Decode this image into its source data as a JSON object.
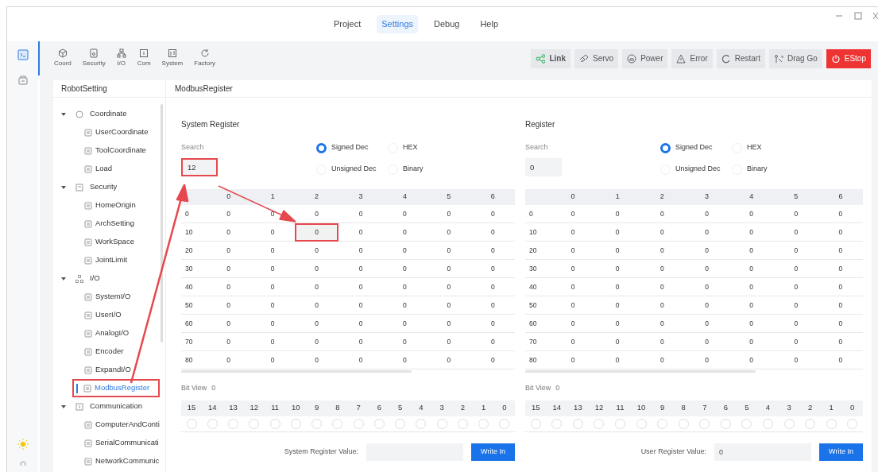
{
  "menu": [
    {
      "label": "Project",
      "selected": false
    },
    {
      "label": "Settings",
      "selected": true
    },
    {
      "label": "Debug",
      "selected": false
    },
    {
      "label": "Help",
      "selected": false
    }
  ],
  "toolbar": {
    "items": [
      {
        "label": "Coord"
      },
      {
        "label": "Security"
      },
      {
        "label": "I/O"
      },
      {
        "label": "Com"
      },
      {
        "label": "System"
      },
      {
        "label": "Factory"
      }
    ],
    "buttons": [
      {
        "label": "Link",
        "kind": "link"
      },
      {
        "label": "Servo",
        "kind": "servo"
      },
      {
        "label": "Power",
        "kind": "power"
      },
      {
        "label": "Error",
        "kind": "error"
      },
      {
        "label": "Restart",
        "kind": "restart"
      },
      {
        "label": "Drag Go",
        "kind": "drag"
      },
      {
        "label": "EStop",
        "kind": "estop"
      }
    ]
  },
  "tree": {
    "title": "RobotSetting",
    "groups": [
      {
        "label": "Coordinate",
        "expanded": true,
        "children": [
          {
            "label": "UserCoordinate",
            "selected": false,
            "highlighted": false
          },
          {
            "label": "ToolCoordinate",
            "selected": false,
            "highlighted": false
          },
          {
            "label": "Load",
            "selected": false,
            "highlighted": false
          }
        ]
      },
      {
        "label": "Security",
        "expanded": true,
        "children": [
          {
            "label": "HomeOrigin",
            "selected": false,
            "highlighted": false
          },
          {
            "label": "ArchSetting",
            "selected": false,
            "highlighted": false
          },
          {
            "label": "WorkSpace",
            "selected": false,
            "highlighted": false
          },
          {
            "label": "JointLimit",
            "selected": false,
            "highlighted": false
          }
        ]
      },
      {
        "label": "I/O",
        "expanded": true,
        "children": [
          {
            "label": "SystemI/O",
            "selected": false,
            "highlighted": false
          },
          {
            "label": "UserI/O",
            "selected": false,
            "highlighted": false
          },
          {
            "label": "AnalogI/O",
            "selected": false,
            "highlighted": false
          },
          {
            "label": "Encoder",
            "selected": false,
            "highlighted": false
          },
          {
            "label": "ExpandI/O",
            "selected": false,
            "highlighted": false
          },
          {
            "label": "ModbusRegister",
            "selected": true,
            "highlighted": true
          }
        ]
      },
      {
        "label": "Communication",
        "expanded": true,
        "children": [
          {
            "label": "ComputerAndConti",
            "selected": false,
            "highlighted": false
          },
          {
            "label": "SerialCommunicati",
            "selected": false,
            "highlighted": false
          },
          {
            "label": "NetworkCommunic",
            "selected": false,
            "highlighted": false
          }
        ]
      }
    ]
  },
  "page_title": "ModbusRegister",
  "panels": [
    {
      "title": "System Register",
      "search_label": "Search",
      "search_value": "12",
      "search_highlighted": true,
      "formats": [
        {
          "label": "Signed Dec",
          "selected": true
        },
        {
          "label": "HEX",
          "selected": false
        },
        {
          "label": "Unsigned Dec",
          "selected": false
        },
        {
          "label": "Binary",
          "selected": false
        }
      ],
      "columns": [
        "0",
        "1",
        "2",
        "3",
        "4",
        "5",
        "6"
      ],
      "rows": [
        {
          "label": "0",
          "values": [
            "0",
            "0",
            "0",
            "0",
            "0",
            "0",
            "0"
          ]
        },
        {
          "label": "10",
          "values": [
            "0",
            "0",
            "0",
            "0",
            "0",
            "0",
            "0"
          ],
          "marked": [
            false,
            false,
            true,
            false,
            false,
            false,
            false
          ]
        },
        {
          "label": "20",
          "values": [
            "0",
            "0",
            "0",
            "0",
            "0",
            "0",
            "0"
          ]
        },
        {
          "label": "30",
          "values": [
            "0",
            "0",
            "0",
            "0",
            "0",
            "0",
            "0"
          ]
        },
        {
          "label": "40",
          "values": [
            "0",
            "0",
            "0",
            "0",
            "0",
            "0",
            "0"
          ]
        },
        {
          "label": "50",
          "values": [
            "0",
            "0",
            "0",
            "0",
            "0",
            "0",
            "0"
          ]
        },
        {
          "label": "60",
          "values": [
            "0",
            "0",
            "0",
            "0",
            "0",
            "0",
            "0"
          ]
        },
        {
          "label": "70",
          "values": [
            "0",
            "0",
            "0",
            "0",
            "0",
            "0",
            "0"
          ]
        },
        {
          "label": "80",
          "values": [
            "0",
            "0",
            "0",
            "0",
            "0",
            "0",
            "0"
          ]
        }
      ],
      "bit_view_label": "Bit View",
      "bit_view_value": "0",
      "bits": [
        {
          "label": "15",
          "set": false
        },
        {
          "label": "14",
          "set": false
        },
        {
          "label": "13",
          "set": false
        },
        {
          "label": "12",
          "set": false
        },
        {
          "label": "11",
          "set": false
        },
        {
          "label": "10",
          "set": false
        },
        {
          "label": "9",
          "set": false
        },
        {
          "label": "8",
          "set": false
        },
        {
          "label": "7",
          "set": false
        },
        {
          "label": "6",
          "set": false
        },
        {
          "label": "5",
          "set": false
        },
        {
          "label": "4",
          "set": false
        },
        {
          "label": "3",
          "set": false
        },
        {
          "label": "2",
          "set": false
        },
        {
          "label": "1",
          "set": false
        },
        {
          "label": "0",
          "set": false
        }
      ],
      "value_label": "System Register Value:",
      "write_button": "Write In"
    },
    {
      "title": "Register",
      "search_label": "Search",
      "search_value": "0",
      "search_highlighted": false,
      "formats": [
        {
          "label": "Signed Dec",
          "selected": true
        },
        {
          "label": "HEX",
          "selected": false
        },
        {
          "label": "Unsigned Dec",
          "selected": false
        },
        {
          "label": "Binary",
          "selected": false
        }
      ],
      "columns": [
        "0",
        "1",
        "2",
        "3",
        "4",
        "5",
        "6"
      ],
      "rows": [
        {
          "label": "0",
          "values": [
            "0",
            "0",
            "0",
            "0",
            "0",
            "0",
            "0"
          ]
        },
        {
          "label": "10",
          "values": [
            "0",
            "0",
            "0",
            "0",
            "0",
            "0",
            "0"
          ]
        },
        {
          "label": "20",
          "values": [
            "0",
            "0",
            "0",
            "0",
            "0",
            "0",
            "0"
          ]
        },
        {
          "label": "30",
          "values": [
            "0",
            "0",
            "0",
            "0",
            "0",
            "0",
            "0"
          ]
        },
        {
          "label": "40",
          "values": [
            "0",
            "0",
            "0",
            "0",
            "0",
            "0",
            "0"
          ]
        },
        {
          "label": "50",
          "values": [
            "0",
            "0",
            "0",
            "0",
            "0",
            "0",
            "0"
          ]
        },
        {
          "label": "60",
          "values": [
            "0",
            "0",
            "0",
            "0",
            "0",
            "0",
            "0"
          ]
        },
        {
          "label": "70",
          "values": [
            "0",
            "0",
            "0",
            "0",
            "0",
            "0",
            "0"
          ]
        },
        {
          "label": "80",
          "values": [
            "0",
            "0",
            "0",
            "0",
            "0",
            "0",
            "0"
          ]
        }
      ],
      "bit_view_label": "Bit View",
      "bit_view_value": "0",
      "bits": [
        {
          "label": "15",
          "set": false
        },
        {
          "label": "14",
          "set": false
        },
        {
          "label": "13",
          "set": false
        },
        {
          "label": "12",
          "set": false
        },
        {
          "label": "11",
          "set": false
        },
        {
          "label": "10",
          "set": false
        },
        {
          "label": "9",
          "set": false
        },
        {
          "label": "8",
          "set": false
        },
        {
          "label": "7",
          "set": false
        },
        {
          "label": "6",
          "set": false
        },
        {
          "label": "5",
          "set": false
        },
        {
          "label": "4",
          "set": false
        },
        {
          "label": "3",
          "set": false
        },
        {
          "label": "2",
          "set": false
        },
        {
          "label": "1",
          "set": false
        },
        {
          "label": "0",
          "set": false
        }
      ],
      "value_label": "User Register Value:",
      "value": "0",
      "write_button": "Write In"
    }
  ]
}
